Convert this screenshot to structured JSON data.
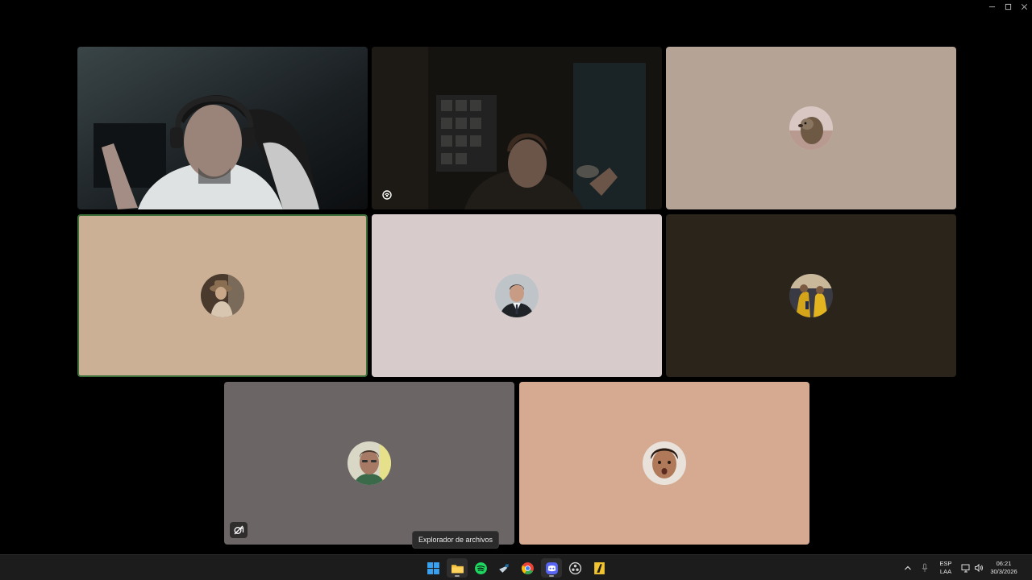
{
  "window": {
    "controls": [
      "minimize-icon",
      "maximize-icon",
      "close-icon"
    ]
  },
  "participants": [
    {
      "id": "p1",
      "type": "camera",
      "background": "#1d2226"
    },
    {
      "id": "p2",
      "type": "camera",
      "background": "#15130f",
      "status_icon": "noise-suppression-icon"
    },
    {
      "id": "p3",
      "type": "avatar",
      "background": "#b5a496",
      "avatar_icon": "marmot-avatar-icon"
    },
    {
      "id": "p4",
      "type": "avatar",
      "background": "#ccb096",
      "speaking": true,
      "avatar_icon": "vintage-photo-avatar-icon"
    },
    {
      "id": "p5",
      "type": "avatar",
      "background": "#d7cbcb",
      "avatar_icon": "man-in-suit-avatar-icon"
    },
    {
      "id": "p6",
      "type": "avatar",
      "background": "#2a241a",
      "avatar_icon": "yellow-jersey-avatar-icon"
    },
    {
      "id": "p7",
      "type": "avatar",
      "background": "#6b6665",
      "status_icon": "camera-off-icon",
      "avatar_icon": "man-face-avatar-icon"
    },
    {
      "id": "p8",
      "type": "avatar",
      "background": "#d5aa91",
      "avatar_icon": "child-face-avatar-icon"
    }
  ],
  "tooltip": {
    "text": "Explorador de archivos"
  },
  "taskbar": {
    "apps": [
      {
        "name": "start",
        "icon": "windows-start-icon",
        "color": "#3aa0f0"
      },
      {
        "name": "file-explorer",
        "icon": "folder-icon",
        "color": "#f5c242",
        "active": true
      },
      {
        "name": "spotify",
        "icon": "spotify-icon",
        "color": "#1ed760"
      },
      {
        "name": "steam",
        "icon": "steam-icon",
        "color": "#c7d5e0"
      },
      {
        "name": "chrome",
        "icon": "chrome-icon",
        "color": "#ea4335"
      },
      {
        "name": "discord",
        "icon": "discord-icon",
        "color": "#5865f2",
        "active": true
      },
      {
        "name": "obs",
        "icon": "obs-icon",
        "color": "#d0d0d0"
      },
      {
        "name": "game",
        "icon": "game-launcher-icon",
        "color": "#f2c330"
      }
    ],
    "tray": {
      "icons": [
        "chevron-up-icon",
        "microphone-icon",
        "network-icon",
        "volume-icon"
      ],
      "language_top": "ESP",
      "language_bottom": "LAA",
      "time": "06:21",
      "date": "30/3/2026"
    }
  }
}
